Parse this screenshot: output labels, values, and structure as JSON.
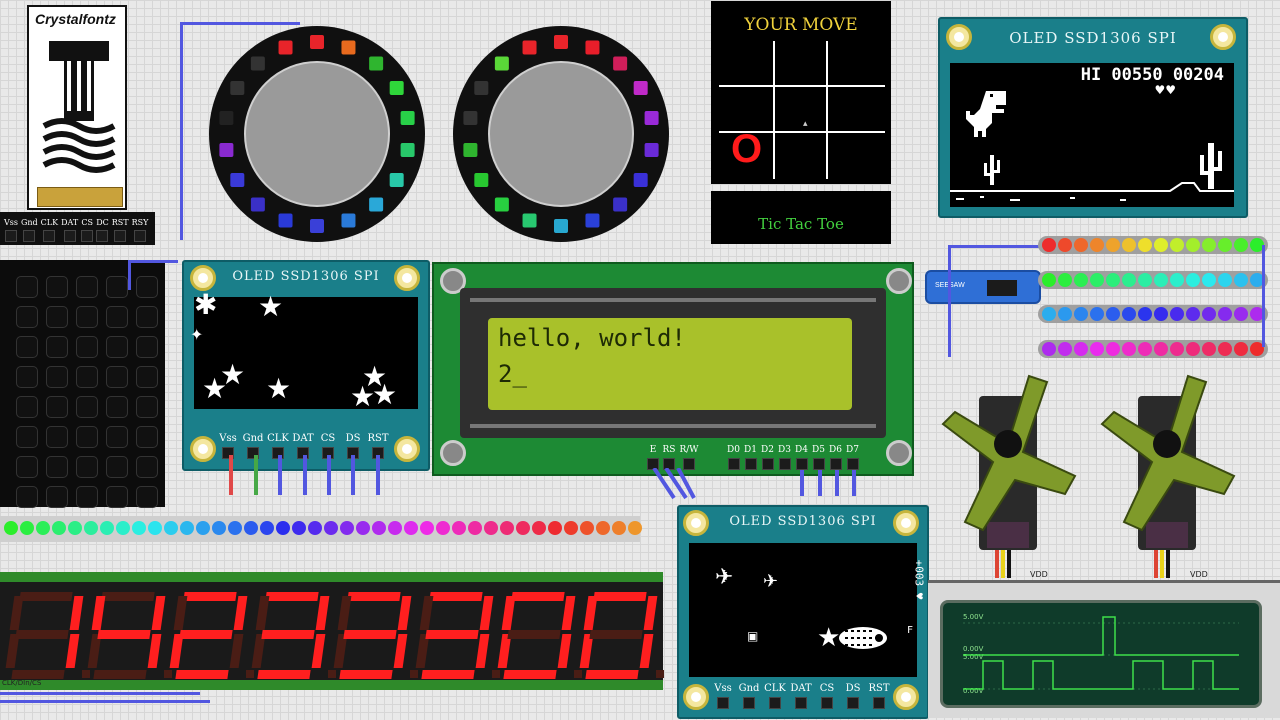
{
  "crystalfontz": {
    "brand": "Crystalfontz",
    "pins": [
      "Vss",
      "Gnd",
      "CLK",
      "DAT",
      "CS",
      "DC",
      "RST",
      "RSY"
    ]
  },
  "tictactoe": {
    "prompt": "YOUR MOVE",
    "mark": "O",
    "caption": "Tic Tac Toe"
  },
  "oled_dino": {
    "title": "OLED SSD1306 SPI",
    "score": "HI 00550 00204",
    "lives": "♥♥"
  },
  "oled_stars": {
    "title": "OLED SSD1306 SPI",
    "pins": [
      "Vss",
      "Gnd",
      "CLK",
      "DAT",
      "CS",
      "DS",
      "RST"
    ]
  },
  "lcd": {
    "line1": "hello, world!",
    "line2": "2_",
    "pins_left": [
      "E",
      "RS",
      "R/W"
    ],
    "pins_right": [
      "D0",
      "D1",
      "D2",
      "D3",
      "D4",
      "D5",
      "D6",
      "D7"
    ]
  },
  "oled_space": {
    "title": "OLED SSD1306 SPI",
    "side_text": "+003 ♥",
    "side_letter": "F",
    "pins": [
      "Vss",
      "Gnd",
      "CLK",
      "DAT",
      "CS",
      "DS",
      "RST"
    ]
  },
  "seesaw": {
    "label": "SEESAW"
  },
  "servos": {
    "vdd_label": "VDD"
  },
  "seven_segment": {
    "value": "14233300",
    "footer": "CLK/DIn/CS"
  },
  "scope": {
    "ch_top": "5.00V",
    "ch_mid_a": "0.00V",
    "ch_mid_b": "5.00V",
    "ch_bot": "0.00V"
  },
  "colors": {
    "pcb_teal": "#1a7f8a",
    "lcd_green": "#a9c12a",
    "seg_on": "#ff1f1f",
    "wire_blue": "#5257e0"
  }
}
